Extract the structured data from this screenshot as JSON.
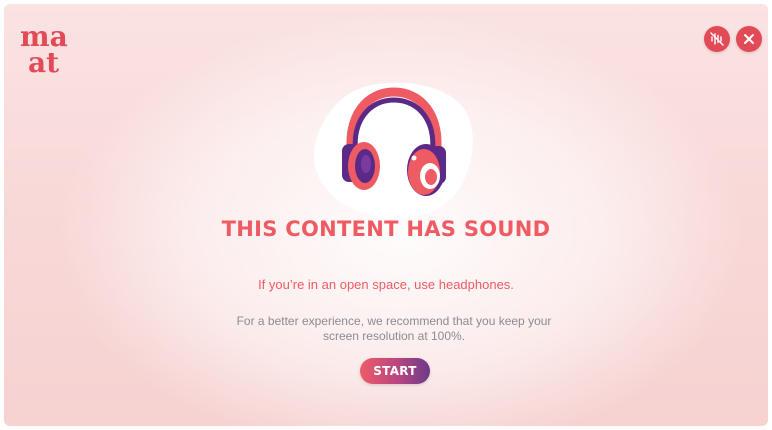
{
  "brand": {
    "logo_text_top": "ma",
    "logo_text_bottom": "at",
    "logo_color": "#e24a58"
  },
  "controls": {
    "sound_icon": "sound-wave-off-icon",
    "close_icon": "close-icon",
    "button_color": "#e24a58"
  },
  "main": {
    "illustration_icon": "headphones-icon",
    "title": "THIS CONTENT HAS SOUND",
    "subtitle": "If you’re in an open space, use headphones.",
    "note_line1": "For a better experience, we recommend that you keep your",
    "note_line2": "screen resolution at 100%.",
    "start_label": "START"
  },
  "colors": {
    "accent": "#ef5b63",
    "purple": "#5b2a86",
    "muted_text": "#8b8b93"
  }
}
